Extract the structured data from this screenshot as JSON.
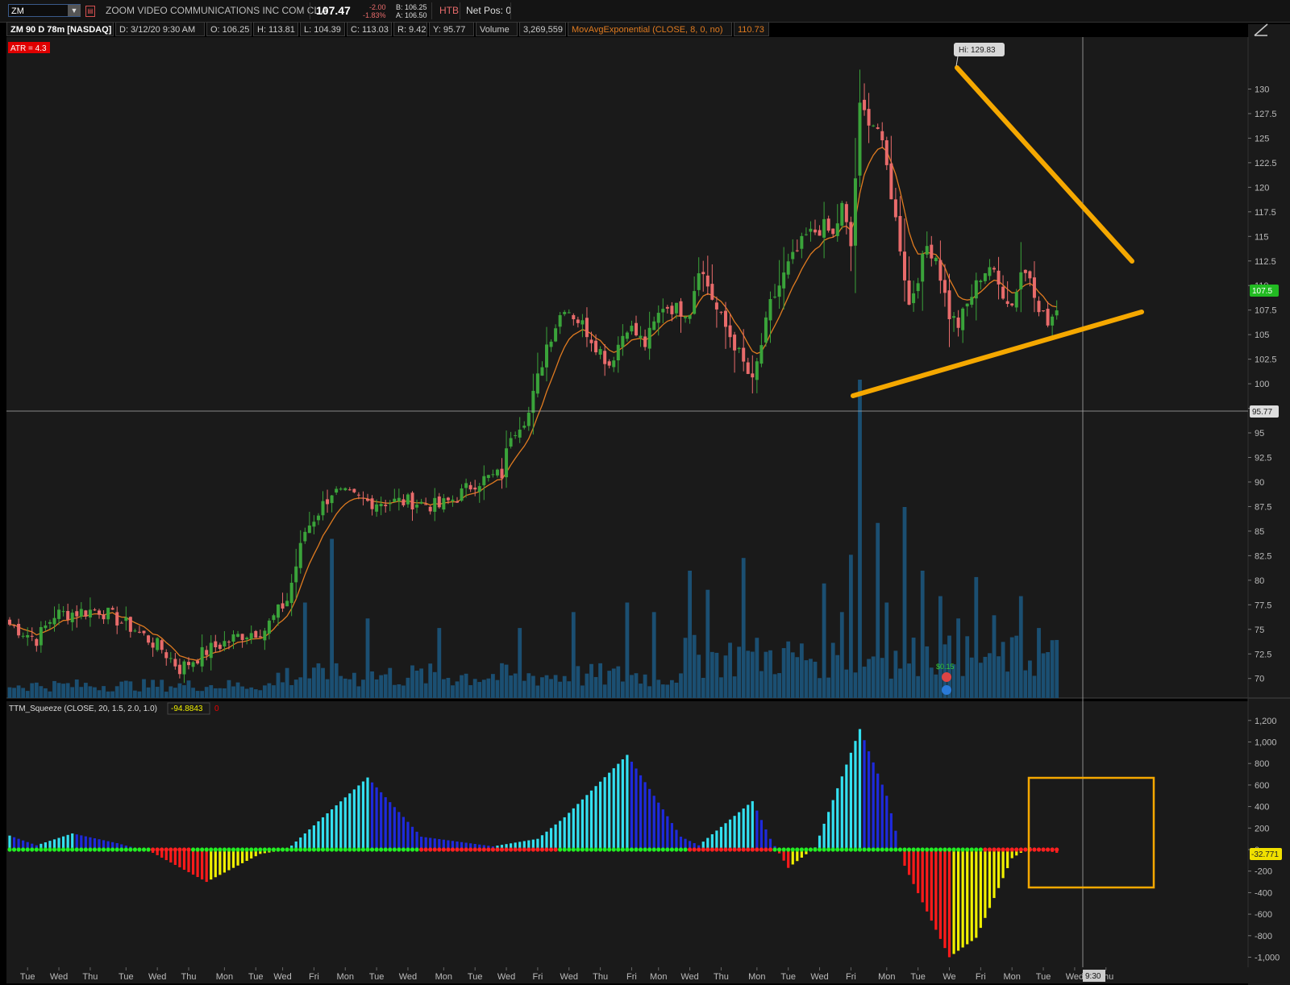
{
  "header": {
    "symbol": "ZM",
    "company": "ZOOM VIDEO COMMUNICATIONS INC COM CL A",
    "last_price": "107.47",
    "change": "-2.00",
    "change_pct": "-1.83%",
    "bid": "B: 106.25",
    "ask": "A: 106.50",
    "htb": "HTB",
    "net_pos": "Net Pos: 0"
  },
  "info_bar": {
    "chart_id": "ZM 90 D 78m [NASDAQ]",
    "date": "D: 3/12/20 9:30 AM",
    "open": "O: 106.25",
    "high": "H: 113.81",
    "low": "L: 104.39",
    "close": "C: 113.03",
    "range": "R: 9.42",
    "y_value": "Y: 95.77",
    "volume_label": "Volume",
    "volume_value": "3,269,559",
    "study": "MovAvgExponential (CLOSE, 8, 0, no)",
    "study_value": "110.73"
  },
  "colors": {
    "background": "#1a1a1a",
    "up_candle": "#3aa33a",
    "down_candle": "#e86b6b",
    "ema": "#e07b20",
    "volume": "#1b4f72",
    "annotation": "#f5a800",
    "histogram_cyan": "#33e0f0",
    "histogram_blue": "#1e2adc",
    "histogram_red": "#ff1a1a",
    "histogram_yellow": "#f0f000",
    "squeeze_on": "#ff2020",
    "squeeze_off": "#22ee22"
  },
  "atr_label": "ATR = 4.3",
  "hi_label": "Hi: 129.83",
  "dividend_label": "$0.15",
  "price_badge": "107.5",
  "crosshair_badge": "95.77",
  "study2": {
    "label": "TTM_Squeeze (CLOSE, 20, 1.5, 2.0, 1.0)",
    "value": "-94.8843",
    "flag": "0",
    "badge": "-32.771"
  },
  "time_badge": "9:30",
  "chart_data": [
    {
      "type": "candlestick",
      "y_ticks": [
        "130",
        "127.5",
        "125",
        "122.5",
        "120",
        "117.5",
        "115",
        "112.5",
        "110",
        "107.5",
        "105",
        "102.5",
        "100",
        "97.5",
        "95",
        "92.5",
        "90",
        "87.5",
        "85",
        "82.5",
        "80",
        "77.5",
        "75",
        "72.5",
        "70"
      ],
      "ylim": [
        68.5,
        132.5
      ],
      "anchors": [
        [
          0,
          75.5
        ],
        [
          6,
          74
        ],
        [
          10,
          76.5
        ],
        [
          20,
          77
        ],
        [
          28,
          75
        ],
        [
          34,
          73
        ],
        [
          38,
          71
        ],
        [
          44,
          72.8
        ],
        [
          52,
          74.5
        ],
        [
          57,
          75
        ],
        [
          62,
          78
        ],
        [
          66,
          85
        ],
        [
          72,
          89
        ],
        [
          80,
          88
        ],
        [
          90,
          88
        ],
        [
          96,
          87.5
        ],
        [
          100,
          88.5
        ],
        [
          104,
          90
        ],
        [
          110,
          90.8
        ],
        [
          112,
          95
        ],
        [
          116,
          97
        ],
        [
          120,
          104
        ],
        [
          124,
          108
        ],
        [
          128,
          106
        ],
        [
          134,
          102
        ],
        [
          138,
          106
        ],
        [
          142,
          104
        ],
        [
          146,
          108
        ],
        [
          150,
          107.5
        ],
        [
          152,
          107.5
        ],
        [
          154,
          112
        ],
        [
          156,
          110
        ],
        [
          158,
          107.5
        ],
        [
          162,
          104
        ],
        [
          166,
          100
        ],
        [
          170,
          108
        ],
        [
          174,
          112
        ],
        [
          178,
          115
        ],
        [
          182,
          116
        ],
        [
          184,
          115
        ],
        [
          186,
          118
        ],
        [
          188,
          114
        ],
        [
          190,
          128
        ],
        [
          192,
          127
        ],
        [
          194,
          126
        ],
        [
          196,
          122
        ],
        [
          199,
          114
        ],
        [
          201,
          108
        ],
        [
          203,
          111
        ],
        [
          205,
          114
        ],
        [
          207,
          113
        ],
        [
          210,
          107
        ],
        [
          212,
          106
        ],
        [
          214,
          108
        ],
        [
          217,
          111
        ],
        [
          219,
          112
        ],
        [
          221,
          110
        ],
        [
          224,
          108
        ],
        [
          226,
          111.5
        ],
        [
          228,
          111
        ],
        [
          230,
          108
        ],
        [
          232,
          106
        ],
        [
          234,
          107.5
        ]
      ],
      "ema_period": 8,
      "last_close": 107.47
    },
    {
      "type": "bar",
      "series": [
        {
          "name": "Volume"
        }
      ],
      "spikes": [
        [
          66,
          30
        ],
        [
          72,
          50
        ],
        [
          80,
          25
        ],
        [
          96,
          22
        ],
        [
          114,
          22
        ],
        [
          126,
          27
        ],
        [
          138,
          30
        ],
        [
          144,
          27
        ],
        [
          152,
          40
        ],
        [
          156,
          34
        ],
        [
          164,
          44
        ],
        [
          182,
          36
        ],
        [
          186,
          27
        ],
        [
          188,
          45
        ],
        [
          190,
          100
        ],
        [
          194,
          55
        ],
        [
          196,
          30
        ],
        [
          200,
          60
        ],
        [
          204,
          40
        ],
        [
          208,
          32
        ],
        [
          212,
          25
        ],
        [
          216,
          38
        ],
        [
          220,
          26
        ],
        [
          226,
          32
        ],
        [
          230,
          22
        ]
      ]
    },
    {
      "type": "bar",
      "series": [
        {
          "name": "TTM_Squeeze"
        }
      ],
      "y_ticks": [
        "1,200",
        "1,000",
        "800",
        "600",
        "400",
        "200",
        "0",
        "-200",
        "-400",
        "-600",
        "-800",
        "-1,000"
      ],
      "ylim": [
        -1000,
        1200
      ],
      "anchors": [
        [
          0,
          130
        ],
        [
          6,
          40
        ],
        [
          14,
          150
        ],
        [
          24,
          60
        ],
        [
          32,
          -30
        ],
        [
          44,
          -300
        ],
        [
          56,
          -40
        ],
        [
          62,
          0
        ],
        [
          70,
          300
        ],
        [
          80,
          670
        ],
        [
          92,
          120
        ],
        [
          108,
          30
        ],
        [
          118,
          100
        ],
        [
          124,
          300
        ],
        [
          138,
          880
        ],
        [
          150,
          120
        ],
        [
          154,
          40
        ],
        [
          166,
          450
        ],
        [
          170,
          100
        ],
        [
          174,
          -170
        ],
        [
          180,
          20
        ],
        [
          190,
          1120
        ],
        [
          196,
          500
        ],
        [
          200,
          -150
        ],
        [
          210,
          -1000
        ],
        [
          216,
          -820
        ],
        [
          224,
          -80
        ],
        [
          228,
          20
        ],
        [
          234,
          -30
        ]
      ],
      "squeeze_dot_ranges": [
        [
          32,
          40
        ],
        [
          92,
          122
        ],
        [
          152,
          170
        ],
        [
          218,
          234
        ]
      ],
      "x_ticks": [
        "Tue",
        "Wed",
        "Thu",
        "Tue",
        "Wed",
        "Thu",
        "Mon",
        "Tue",
        "Wed",
        "Fri",
        "Mon",
        "Tue",
        "Wed",
        "Mon",
        "Tue",
        "Wed",
        "Fri",
        "Wed",
        "Thu",
        "Fri",
        "Mon",
        "Wed",
        "Thu",
        "Mon",
        "Tue",
        "Wed",
        "Fri",
        "Mon",
        "Tue",
        "We",
        "Fri",
        "Mon",
        "Tue",
        "Wed",
        "Thu"
      ],
      "x_tick_bars": [
        4,
        11,
        18,
        26,
        33,
        40,
        48,
        55,
        61,
        68,
        75,
        82,
        89,
        97,
        104,
        111,
        118,
        125,
        132,
        139,
        145,
        152,
        159,
        167,
        174,
        181,
        188,
        196,
        203,
        210,
        217,
        224,
        231,
        238,
        245
      ]
    }
  ]
}
